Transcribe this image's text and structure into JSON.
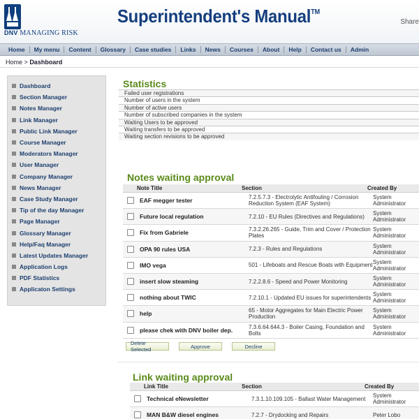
{
  "brand": {
    "logo_text": "DNV",
    "tagline": "MANAGING RISK",
    "app_title": "Superintendent's",
    "app_title_2": "Manual",
    "trademark": "TM",
    "share_label": "Share"
  },
  "topnav": [
    "Home",
    "My menu",
    "Content",
    "Glossary",
    "Case studies",
    "Links",
    "News",
    "Courses",
    "About",
    "Help",
    "Contact us",
    "Admin"
  ],
  "breadcrumb": {
    "home": "Home",
    "separator": ">",
    "current": "Dashboard"
  },
  "sidebar": [
    "Dashboard",
    "Section Manager",
    "Notes Manager",
    "Link Manager",
    "Public Link Manager",
    "Course Manager",
    "Moderators Manager",
    "User Manager",
    "Company Manager",
    "News Manager",
    "Case Study Manager",
    "Tip of the day Manager",
    "Page Manager",
    "Glossary Manager",
    "Help/Faq Manager",
    "Latest Updates Manager",
    "Application Logs",
    "PDF Statistics",
    "Applicaton Settings"
  ],
  "statistics": {
    "title": "Statistics",
    "rows": [
      "Failed user registrations",
      "Number of users in the system",
      "Number of active users",
      "Number of subscribed companies in the system",
      "Waiting Users to be approved",
      "Waiting transfers to be approved",
      "Waiting section revisions to be approved"
    ]
  },
  "notes": {
    "title": "Notes waiting approval",
    "headers": {
      "title": "Note Title",
      "section": "Section",
      "created": "Created By"
    },
    "rows": [
      {
        "title": "EAF megger tester",
        "section": "7.2.5.7.3 - Electrolytic Antifouling / Corrosion Reduction System (EAF System)",
        "created": "System Administrator"
      },
      {
        "title": "Future local regulation",
        "section": "7.2.10 - EU Rules (Directives and Regulations)",
        "created": "System Administrator"
      },
      {
        "title": "Fix from Gabriele",
        "section": "7.3.2.26.265 - Guide, Trim and Cover / Protection Plates",
        "created": "System Administrator"
      },
      {
        "title": "OPA 90 rules USA",
        "section": "7.2.3 - Rules and Regulations",
        "created": "System Administrator"
      },
      {
        "title": "IMO vega",
        "section": "501 - Lifeboats and Rescue Boats with Equipment",
        "created": "System Administrator"
      },
      {
        "title": "insert slow steaming",
        "section": "7.2.2.8.6 - Speed and Power Monitoring",
        "created": "System Administrator"
      },
      {
        "title": "nothing about TWIC",
        "section": "7.2.10.1 - Updated EU issues for superintendents",
        "created": "System Administrator"
      },
      {
        "title": "help",
        "section": "65 - Motor Aggregates for Main Electric Power Production",
        "created": "System Administrator"
      },
      {
        "title": "please chek with DNV boiler dep.",
        "section": "7.3.6.64.644.3 - Boiler Casing, Foundation and Bolts",
        "created": "System Administrator"
      }
    ],
    "buttons": {
      "delete": "Delete Selected",
      "approve": "Approve",
      "decline": "Decline"
    }
  },
  "links": {
    "title": "Link waiting approval",
    "headers": {
      "title": "Link Title",
      "section": "Section",
      "created": "Created By"
    },
    "rows": [
      {
        "title": "Technical eNewsletter",
        "section": "7.3.1.10.109.105 - Ballast Water Management",
        "created": "System Administrator"
      },
      {
        "title": "MAN B&W diesel engines",
        "section": "7.2.7 - Drydocking and Repairs",
        "created": "Peter Lobo"
      }
    ]
  }
}
